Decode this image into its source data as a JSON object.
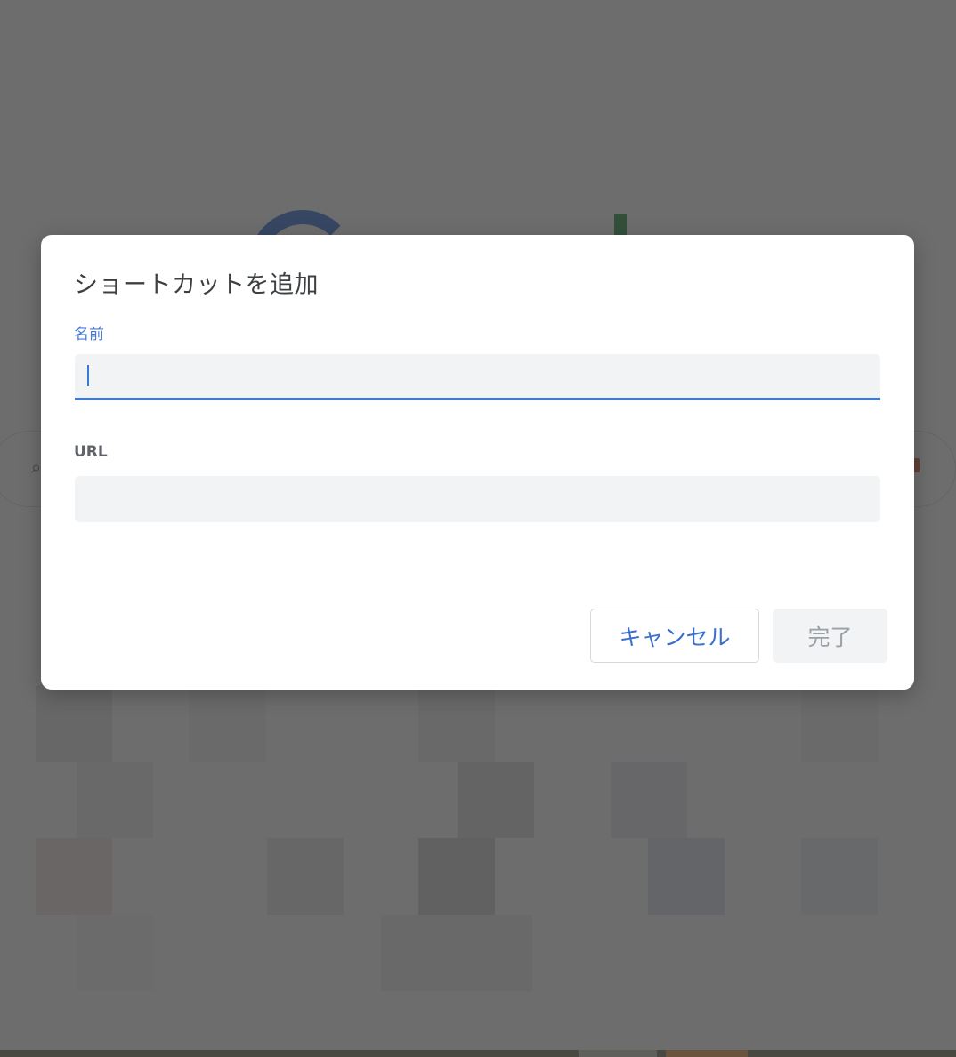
{
  "dialog": {
    "title": "ショートカットを追加",
    "name_label": "名前",
    "name_value": "",
    "url_label": "URL",
    "url_value": "",
    "cancel_label": "キャンセル",
    "done_label": "完了"
  },
  "colors": {
    "accent": "#3a79d8",
    "overlay": "#3a3a3a",
    "input_bg": "#f1f3f4"
  },
  "icons": {
    "name_cursor": "text-cursor-icon"
  }
}
